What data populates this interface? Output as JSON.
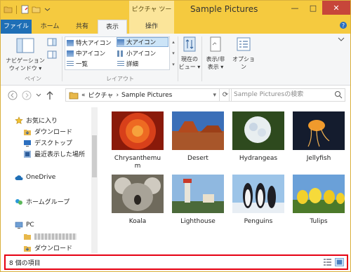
{
  "window": {
    "title": "Sample Pictures",
    "context_tab_group": "ピクチャ ツール",
    "caption": {
      "minimize": "—",
      "maximize": "□",
      "close": "✕"
    }
  },
  "ribbon_tabs": [
    {
      "label": "ファイル"
    },
    {
      "label": "ホーム"
    },
    {
      "label": "共有"
    },
    {
      "label": "表示"
    },
    {
      "label": "操作"
    }
  ],
  "ribbon": {
    "navigation_pane": "ナビゲーション\nウィンドウ ▾",
    "pane_group": "ペイン",
    "layout_group": "レイアウト",
    "layout_items": [
      {
        "label": "特大アイコン",
        "selected": false
      },
      {
        "label": "大アイコン",
        "selected": true
      },
      {
        "label": "中アイコン",
        "selected": false
      },
      {
        "label": "小アイコン",
        "selected": false
      },
      {
        "label": "一覧",
        "selected": false
      },
      {
        "label": "詳細",
        "selected": false
      }
    ],
    "current_view": "現在の\nビュー ▾",
    "show_hide": "表示/非\n表示 ▾",
    "options": "オプション"
  },
  "address": {
    "breadcrumb_prefix": "«",
    "crumbs": [
      "ピクチャ",
      "Sample Pictures"
    ],
    "search_placeholder": "Sample Picturesの検索"
  },
  "nav_pane": {
    "favorites": "お気に入り",
    "favorites_items": [
      "ダウンロード",
      "デスクトップ",
      "最近表示した場所"
    ],
    "onedrive": "OneDrive",
    "homegroup": "ホームグループ",
    "pc": "PC",
    "pc_items": [
      "ダウンロード"
    ]
  },
  "files": [
    {
      "name": "Chrysanthemum",
      "line1": "Chrysanthemu",
      "line2": "m",
      "thumb": "chrysanthemum"
    },
    {
      "name": "Desert",
      "thumb": "desert"
    },
    {
      "name": "Hydrangeas",
      "thumb": "hydrangeas"
    },
    {
      "name": "Jellyfish",
      "thumb": "jellyfish"
    },
    {
      "name": "Koala",
      "thumb": "koala"
    },
    {
      "name": "Lighthouse",
      "thumb": "lighthouse"
    },
    {
      "name": "Penguins",
      "thumb": "penguins"
    },
    {
      "name": "Tulips",
      "thumb": "tulips"
    }
  ],
  "status": {
    "item_count": "8 個の項目"
  },
  "colors": {
    "titlebar": "#f5ca3f",
    "file_tab": "#1f6fb6",
    "status_highlight": "#e60012"
  }
}
